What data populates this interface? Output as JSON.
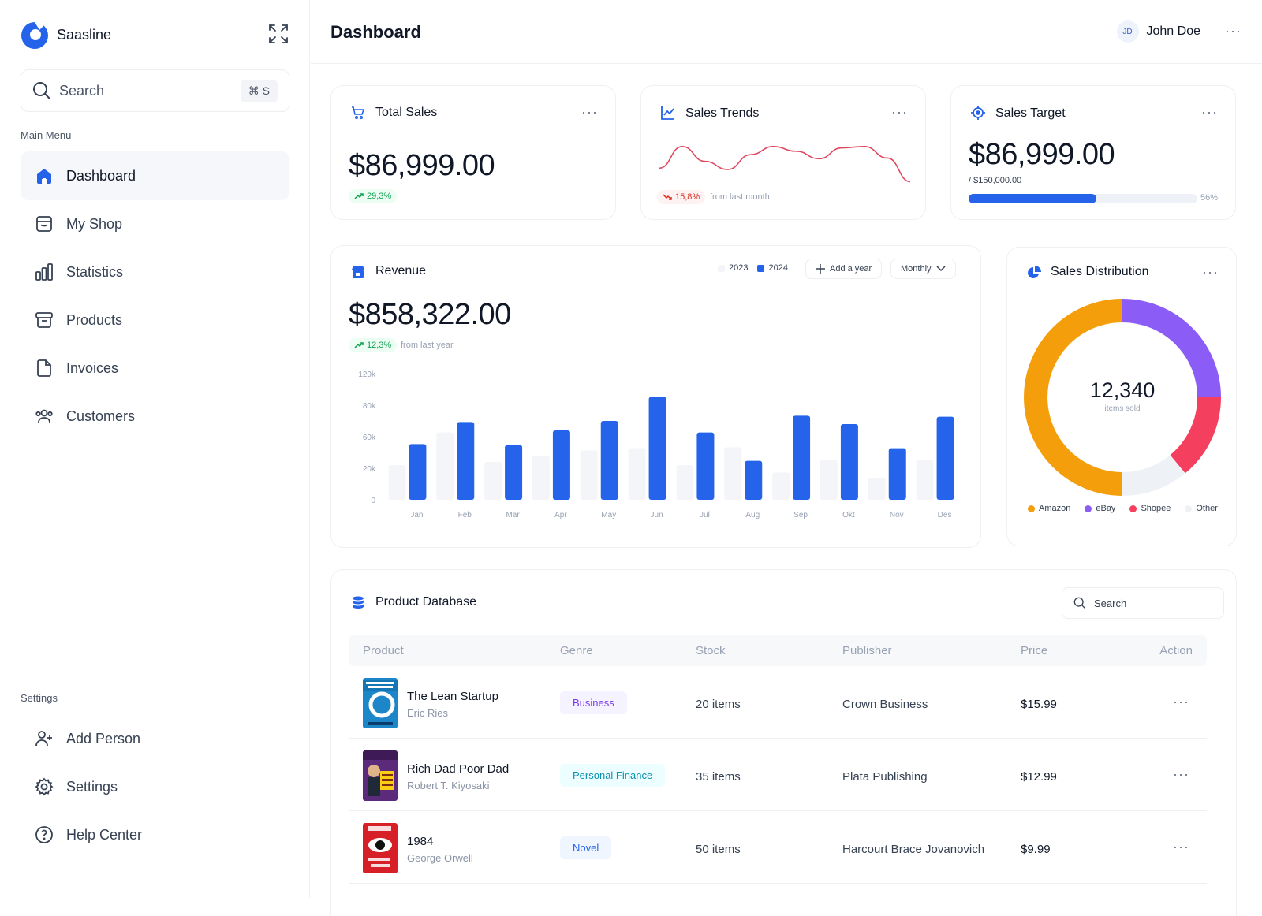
{
  "app": {
    "name": "Saasline"
  },
  "search": {
    "label": "Search",
    "shortcut": "⌘ S"
  },
  "sidebar": {
    "main_menu_label": "Main Menu",
    "items": [
      {
        "label": "Dashboard",
        "icon": "home-icon",
        "active": true
      },
      {
        "label": "My Shop",
        "icon": "shop-icon"
      },
      {
        "label": "Statistics",
        "icon": "bar-chart-icon"
      },
      {
        "label": "Products",
        "icon": "archive-icon"
      },
      {
        "label": "Invoices",
        "icon": "file-icon"
      },
      {
        "label": "Customers",
        "icon": "users-icon"
      }
    ],
    "settings_label": "Settings",
    "settings_items": [
      {
        "label": "Add Person",
        "icon": "user-plus-icon"
      },
      {
        "label": "Settings",
        "icon": "gear-icon"
      },
      {
        "label": "Help Center",
        "icon": "help-icon"
      }
    ]
  },
  "header": {
    "title": "Dashboard",
    "user_initials": "JD",
    "user_name": "John Doe"
  },
  "cards": {
    "total_sales": {
      "title": "Total Sales",
      "value": "$86,999.00",
      "change": "29,3%"
    },
    "sales_trends": {
      "title": "Sales Trends",
      "change": "15,8%",
      "note": "from last month"
    },
    "sales_target": {
      "title": "Sales Target",
      "value": "$86,999.00",
      "target": "/ $150,000.00",
      "progress": 0.56,
      "progress_label": "56%"
    }
  },
  "revenue": {
    "title": "Revenue",
    "value": "$858,322.00",
    "change": "12,3%",
    "note": "from last year",
    "legend": [
      "2023",
      "2024"
    ],
    "add_year_label": "Add a year",
    "period": "Monthly"
  },
  "distribution": {
    "title": "Sales Distribution",
    "total": "12,340",
    "total_label": "items sold",
    "legend": [
      {
        "name": "Amazon",
        "color": "#f59e0b"
      },
      {
        "name": "eBay",
        "color": "#8b5cf6"
      },
      {
        "name": "Shopee",
        "color": "#f43f5e"
      },
      {
        "name": "Other",
        "color": "#eef1f6"
      }
    ]
  },
  "chart_data": [
    {
      "type": "line",
      "values": [
        30,
        62,
        40,
        28,
        50,
        62,
        55,
        44,
        60,
        62,
        45,
        10
      ]
    },
    {
      "type": "bar",
      "categories": [
        "Jan",
        "Feb",
        "Mar",
        "Apr",
        "May",
        "Jun",
        "Jul",
        "Aug",
        "Sep",
        "Okt",
        "Nov",
        "Des"
      ],
      "yticks": [
        "0",
        "20k",
        "60k",
        "80k",
        "120k"
      ],
      "ylim": [
        0,
        120
      ],
      "series": [
        {
          "name": "2023",
          "values": [
            33,
            64,
            36,
            42,
            47,
            49,
            33,
            50,
            26,
            38,
            21,
            38
          ],
          "color": "#f3f5f8"
        },
        {
          "name": "2024",
          "values": [
            53,
            74,
            52,
            66,
            75,
            98,
            64,
            37,
            80,
            72,
            49,
            79
          ],
          "color": "#2563eb"
        }
      ]
    },
    {
      "type": "pie",
      "labels": [
        "Amazon",
        "eBay",
        "Shopee",
        "Other"
      ],
      "values": [
        50,
        25,
        14,
        11
      ]
    }
  ],
  "products": {
    "title": "Product Database",
    "search_placeholder": "Search",
    "columns": [
      "Product",
      "Genre",
      "Stock",
      "Publisher",
      "Price",
      "Action"
    ],
    "rows": [
      {
        "name": "The Lean Startup",
        "author": "Eric Ries",
        "genre": "Business",
        "stock": "20 items",
        "publisher": "Crown Business",
        "price": "$15.99"
      },
      {
        "name": "Rich Dad Poor Dad",
        "author": "Robert T. Kiyosaki",
        "genre": "Personal Finance",
        "stock": "35 items",
        "publisher": "Plata Publishing",
        "price": "$12.99"
      },
      {
        "name": "1984",
        "author": "George Orwell",
        "genre": "Novel",
        "stock": "50 items",
        "publisher": "Harcourt Brace Jovanovich",
        "price": "$9.99"
      }
    ]
  }
}
